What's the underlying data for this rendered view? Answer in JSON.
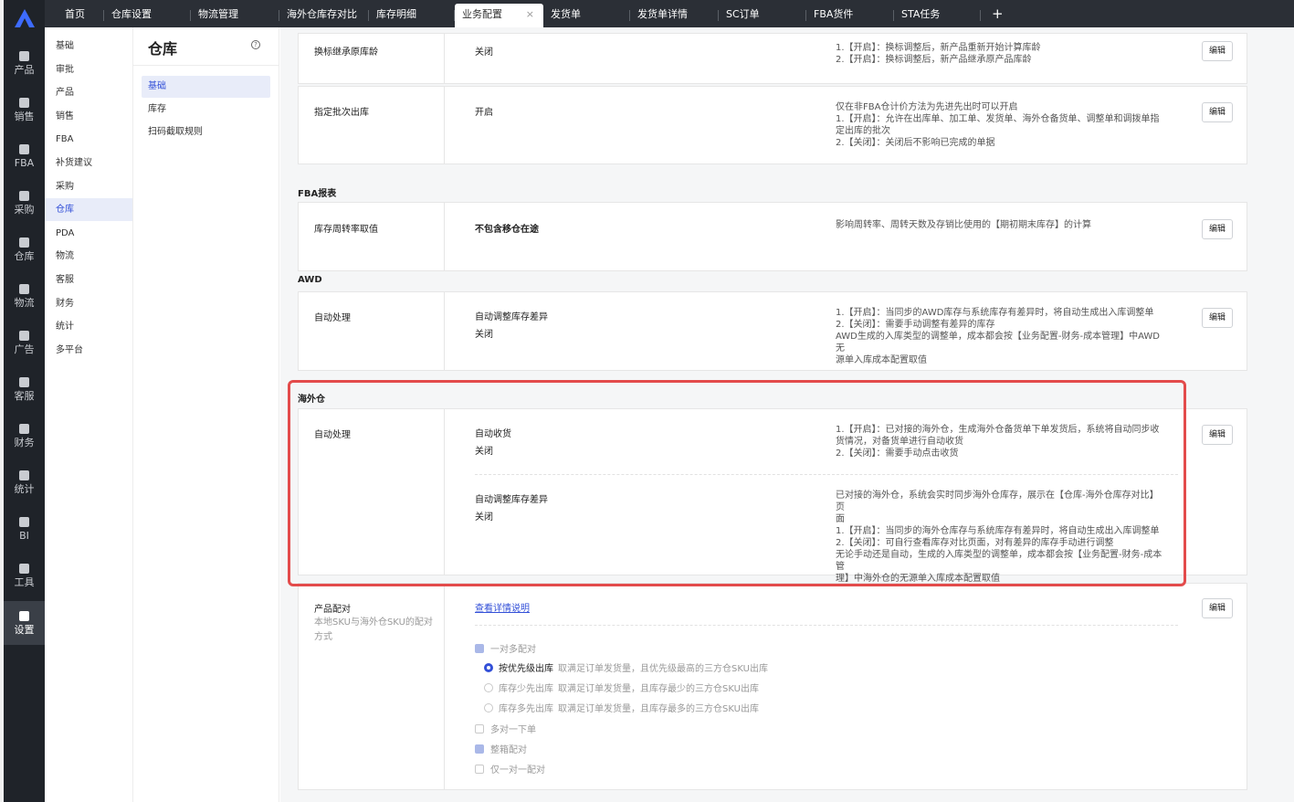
{
  "rail": {
    "items": [
      {
        "label": "产品",
        "icon": "box-icon"
      },
      {
        "label": "销售",
        "icon": "shop-icon"
      },
      {
        "label": "FBA",
        "icon": "fba-icon"
      },
      {
        "label": "采购",
        "icon": "cart-icon"
      },
      {
        "label": "仓库",
        "icon": "warehouse-icon"
      },
      {
        "label": "物流",
        "icon": "truck-icon"
      },
      {
        "label": "广告",
        "icon": "ad-icon"
      },
      {
        "label": "客服",
        "icon": "mail-icon"
      },
      {
        "label": "财务",
        "icon": "coin-icon"
      },
      {
        "label": "统计",
        "icon": "pie-icon"
      },
      {
        "label": "BI",
        "icon": "bi-icon"
      },
      {
        "label": "工具",
        "icon": "wrench-icon"
      },
      {
        "label": "设置",
        "icon": "gear-icon"
      }
    ],
    "active": "设置"
  },
  "tabs": [
    "首页",
    "仓库设置",
    "物流管理",
    "海外仓库存对比",
    "库存明细",
    "业务配置",
    "发货单",
    "发货单详情",
    "SC订单",
    "FBA货件",
    "STA任务"
  ],
  "tabs_active": "业务配置",
  "tab_close": "×",
  "tab_add": "+",
  "subnav": [
    "基础",
    "审批",
    "产品",
    "销售",
    "FBA",
    "补货建议",
    "采购",
    "仓库",
    "PDA",
    "物流",
    "客服",
    "财务",
    "统计",
    "多平台"
  ],
  "subnav_active": "仓库",
  "col3": {
    "title": "仓库",
    "help": "?",
    "items": [
      "基础",
      "库存",
      "扫码截取规则"
    ],
    "active": "基础"
  },
  "edit_label": "编辑",
  "cards": {
    "c1": {
      "label": "换标继承原库龄",
      "value": "关闭",
      "desc": [
        "1.【开启】：换标调整后，新产品重新开始计算库龄",
        "2.【开启】：换标调整后，新产品继承原产品库龄"
      ]
    },
    "c2": {
      "label": "指定批次出库",
      "value": "开启",
      "desc": [
        "仅在非FBA仓计价方法为先进先出时可以开启",
        "1.【开启】：允许在出库单、加工单、发货单、海外仓备货单、调整单和调拨单指",
        "定出库的批次",
        "2.【关闭】：关闭后不影响已完成的单据"
      ]
    },
    "fba_section": "FBA报表",
    "c3": {
      "label": "库存周转率取值",
      "value": "不包含移仓在途",
      "desc": [
        "影响周转率、周转天数及存销比使用的【期初期末库存】的计算"
      ]
    },
    "awd_section": "AWD",
    "c4": {
      "label": "自动处理",
      "sub": "自动调整库存差异",
      "value": "关闭",
      "desc": [
        "1.【开启】：当同步的AWD库存与系统库存有差异时，将自动生成出入库调整单",
        "2.【关闭】：需要手动调整有差异的库存",
        "AWD生成的入库类型的调整单，成本都会按【业务配置-财务-成本管理】中AWD无",
        "源单入库成本配置取值"
      ]
    },
    "ow_section": "海外仓",
    "c5": {
      "label": "自动处理",
      "r1": {
        "sub": "自动收货",
        "value": "关闭",
        "desc": [
          "1.【开启】：已对接的海外仓，生成海外仓备货单下单发货后，系统将自动同步收",
          "货情况，对备货单进行自动收货",
          "2.【关闭】：需要手动点击收货"
        ]
      },
      "r2": {
        "sub": "自动调整库存差异",
        "value": "关闭",
        "desc": [
          "已对接的海外仓，系统会实时同步海外仓库存，展示在【仓库-海外仓库存对比】页",
          "面",
          "1.【开启】：当同步的海外仓库存与系统库存有差异时，将自动生成出入库调整单",
          "2.【关闭】：可自行查看库存对比页面，对有差异的库存手动进行调整",
          "无论手动还是自动，生成的入库类型的调整单，成本都会按【业务配置-财务-成本管",
          "理】中海外仓的无源单入库成本配置取值"
        ]
      }
    },
    "c6": {
      "label": "产品配对",
      "sub": "本地SKU与海外仓SKU的配对方式",
      "link": "查看详情说明",
      "opt_one_to_many": "一对多配对",
      "radios": [
        {
          "name": "按优先级出库",
          "desc": "取满足订单发货量，且优先级最高的三方仓SKU出库",
          "on": true
        },
        {
          "name": "库存少先出库",
          "desc": "取满足订单发货量，且库存最少的三方仓SKU出库",
          "on": false
        },
        {
          "name": "库存多先出库",
          "desc": "取满足订单发货量，且库存最多的三方仓SKU出库",
          "on": false
        }
      ],
      "opt_many_to_one": "多对一下单",
      "opt_box": "整箱配对",
      "opt_one_to_one": "仅一对一配对"
    }
  }
}
